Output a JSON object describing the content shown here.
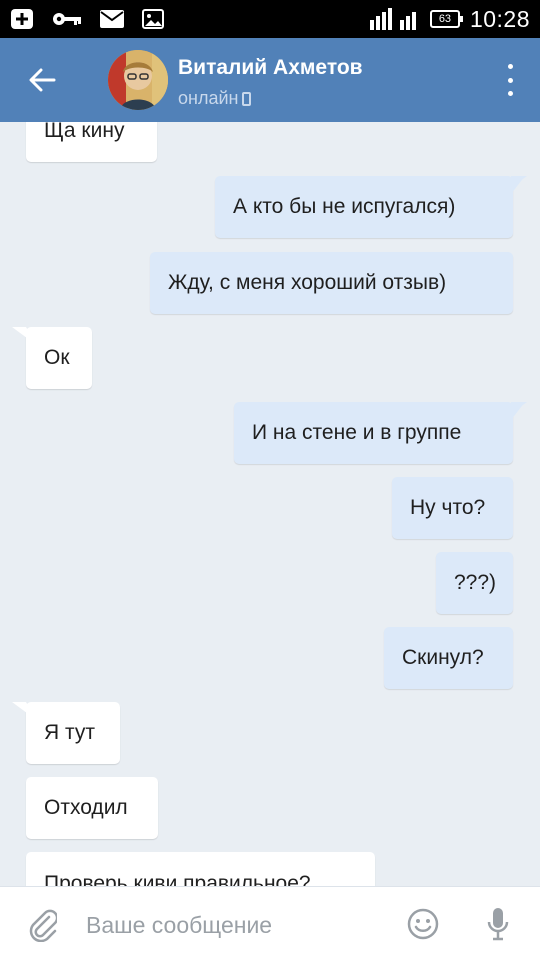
{
  "status_bar": {
    "time": "10:28",
    "battery_level": "63",
    "icons": [
      "add-box-icon",
      "key-icon",
      "mail-icon",
      "image-icon",
      "signal-icon",
      "battery-icon"
    ]
  },
  "header": {
    "contact_name": "Виталий Ахметов",
    "status": "онлайн",
    "icons": [
      "back-arrow-icon",
      "avatar",
      "mobile-phone-icon",
      "more-vertical-icon"
    ],
    "color": "#5181b8"
  },
  "messages": [
    {
      "direction": "in",
      "text": "Ща кину"
    },
    {
      "direction": "out",
      "text": "А кто бы не испугался)"
    },
    {
      "direction": "out",
      "text": "Жду, с меня хороший отзыв)"
    },
    {
      "direction": "in",
      "text": "Ок"
    },
    {
      "direction": "out",
      "text": "И на стене и в группе"
    },
    {
      "direction": "out",
      "text": "Ну что?"
    },
    {
      "direction": "out",
      "text": "???)"
    },
    {
      "direction": "out",
      "text": "Скинул?"
    },
    {
      "direction": "in",
      "text": "Я тут"
    },
    {
      "direction": "in",
      "text": "Отходил"
    },
    {
      "direction": "in",
      "text": "Проверь киви правильное?"
    }
  ],
  "input_bar": {
    "placeholder": "Ваше сообщение",
    "icons": [
      "paperclip-icon",
      "emoji-icon",
      "microphone-icon"
    ]
  },
  "colors": {
    "incoming_bubble": "#ffffff",
    "outgoing_bubble": "#dce9f9",
    "chat_background": "#e9eef3"
  }
}
